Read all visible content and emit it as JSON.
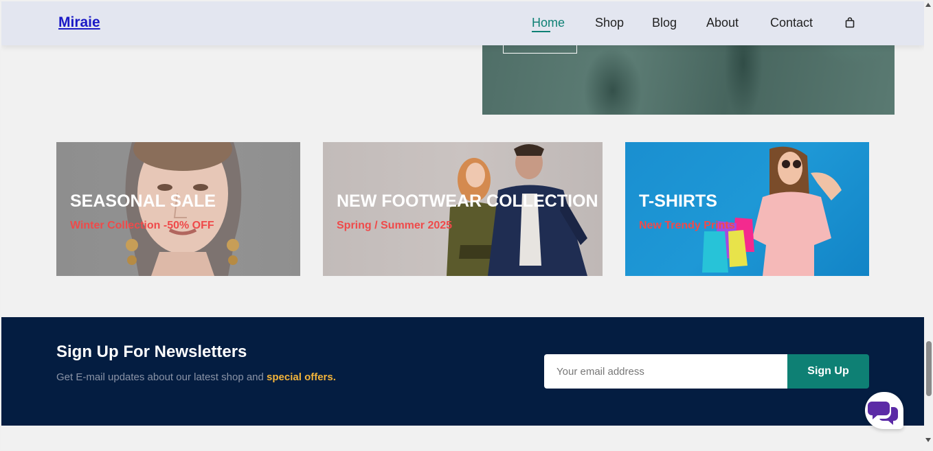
{
  "navbar": {
    "logo": "Miraie",
    "items": [
      {
        "label": "Home",
        "active": true
      },
      {
        "label": "Shop",
        "active": false
      },
      {
        "label": "Blog",
        "active": false
      },
      {
        "label": "About",
        "active": false
      },
      {
        "label": "Contact",
        "active": false
      }
    ],
    "cart_icon": "shopping-bag-icon"
  },
  "banners": [
    {
      "title": "SEASONAL SALE",
      "subtitle": "Winter Collection -50% OFF"
    },
    {
      "title": "NEW FOOTWEAR COLLECTION",
      "subtitle": "Spring / Summer 2025"
    },
    {
      "title": "T-SHIRTS",
      "subtitle": "New Trendy Prints"
    }
  ],
  "newsletter": {
    "title": "Sign Up For Newsletters",
    "text_prefix": "Get E-mail updates about our latest shop and ",
    "text_highlight": "special offers.",
    "placeholder": "Your email address",
    "button_label": "Sign Up"
  },
  "chat_icon": "chat-bubbles-icon",
  "colors": {
    "accent": "#0e8074",
    "logo": "#1a19c6",
    "newsletter_bg": "#041d41",
    "highlight": "#f4b43a",
    "banner_subtitle": "#ef4a4a",
    "chat_icon": "#5b2aa6"
  }
}
